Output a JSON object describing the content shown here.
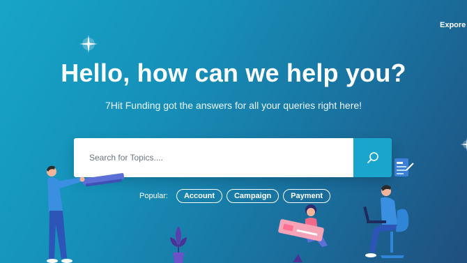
{
  "nav": {
    "explore_label": "Expore"
  },
  "hero": {
    "title": "Hello, how can we help you?",
    "subtitle": "7Hit Funding got the answers for all your queries right here!"
  },
  "search": {
    "placeholder": "Search for Topics....",
    "value": "",
    "button_icon": "search-icon"
  },
  "popular": {
    "label": "Popular:",
    "tags": [
      "Account",
      "Campaign",
      "Payment"
    ]
  },
  "colors": {
    "background_start": "#17a5c7",
    "background_end": "#1f4f7e",
    "search_button": "#1aa6cc",
    "accent_pink": "#f06b8a"
  }
}
